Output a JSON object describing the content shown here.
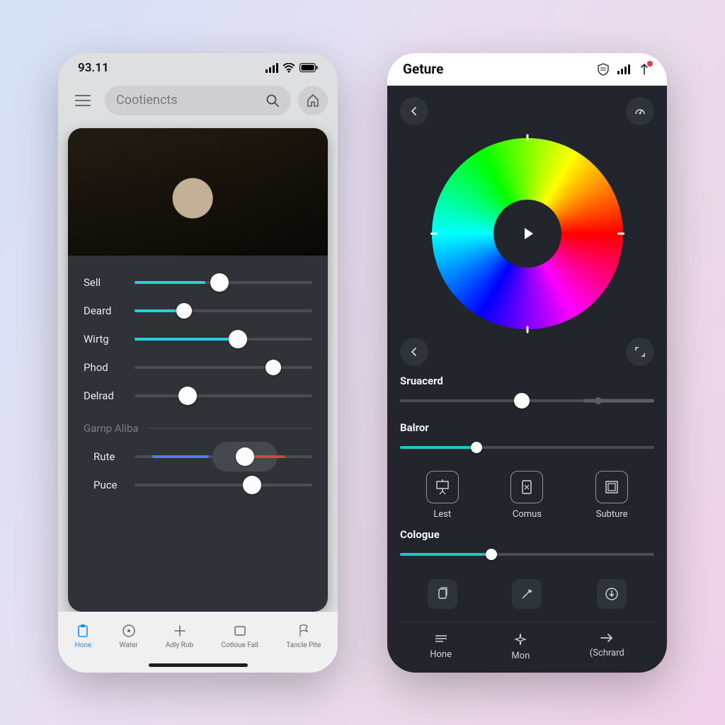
{
  "left": {
    "statusbar": {
      "time": "93.11"
    },
    "search": {
      "placeholder": "Cootiencts"
    },
    "sliders": {
      "sell": {
        "label": "Sell",
        "accent": "#29cfd6",
        "fill_pct": 40,
        "thumb_pct": 48
      },
      "deard": {
        "label": "Deard",
        "accent": "#29cfd6",
        "fill_pct": 28,
        "thumb_pct": 28
      },
      "wirtg": {
        "label": "Wirtg",
        "accent": "#29cfd6",
        "fill_pct": 55,
        "thumb_pct": 58
      },
      "phod": {
        "label": "Phod",
        "accent": "#29cfd6",
        "fill_pct": 0,
        "thumb_pct": 78
      },
      "delrad": {
        "label": "Delrad",
        "accent": "#29cfd6",
        "fill_pct": 0,
        "thumb_pct": 30
      },
      "group": {
        "label": "Garnp Aliba"
      },
      "rute": {
        "label": "Rute",
        "blue_start": 10,
        "blue_end": 42,
        "red_start": 62,
        "red_end": 85,
        "thumb_pct": 62
      },
      "puce": {
        "label": "Puce",
        "thumb_pct": 66
      }
    },
    "nav": {
      "home": {
        "label": "Hone"
      },
      "water": {
        "label": "Water"
      },
      "adly": {
        "label": "Adly Rob"
      },
      "cot": {
        "label": "Cotloue Fall"
      },
      "tancle": {
        "label": "Tancle Pite"
      }
    }
  },
  "right": {
    "title": "Geture",
    "sliders": {
      "saturation": {
        "label": "Sruacerd",
        "thumb_pct": 48,
        "dot_pct": 78
      },
      "balror": {
        "label": "Balror",
        "seg_pct": 30,
        "thumb_pct": 30
      },
      "cologue": {
        "label": "Cologue",
        "seg_pct": 36,
        "thumb_pct": 36
      }
    },
    "presets": {
      "lest": {
        "label": "Lest"
      },
      "comus": {
        "label": "Comus"
      },
      "subture": {
        "label": "Subture"
      }
    },
    "nav": {
      "home": {
        "label": "Hone"
      },
      "mon": {
        "label": "Mon"
      },
      "schard": {
        "label": "(Schrard"
      }
    }
  }
}
